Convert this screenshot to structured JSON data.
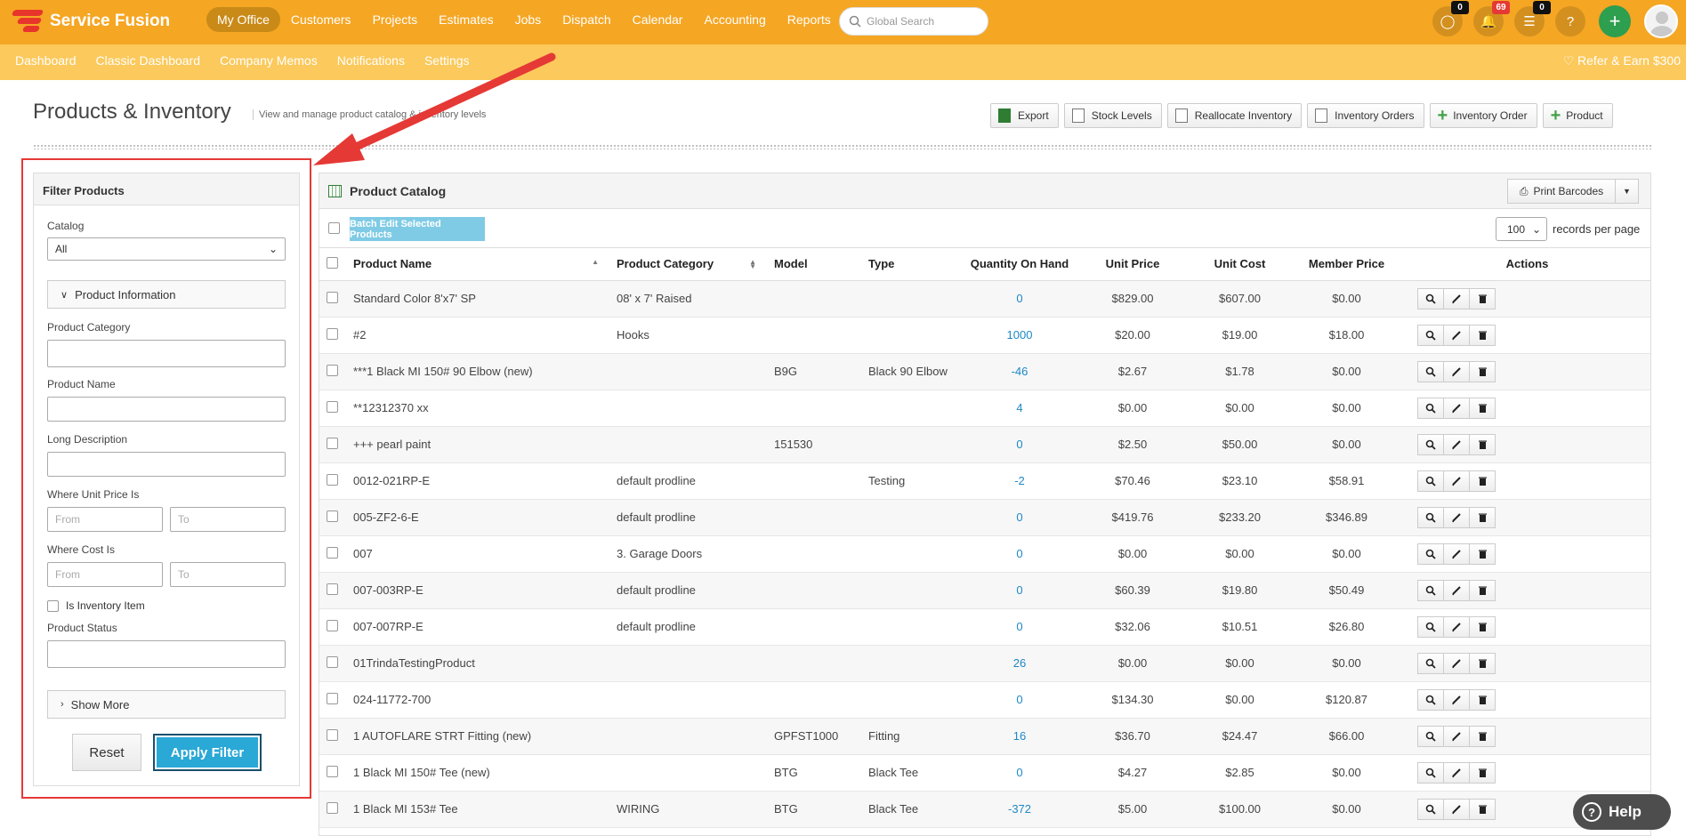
{
  "brand": {
    "name": "Service Fusion"
  },
  "nav": [
    "My Office",
    "Customers",
    "Projects",
    "Estimates",
    "Jobs",
    "Dispatch",
    "Calendar",
    "Accounting",
    "Reports"
  ],
  "nav_active": "My Office",
  "search": {
    "placeholder": "Global Search"
  },
  "badges": {
    "chat": "0",
    "notifications": "69",
    "tasks": "0"
  },
  "subnav": [
    "Dashboard",
    "Classic Dashboard",
    "Company Memos",
    "Notifications",
    "Settings"
  ],
  "refer": "Refer & Earn $300",
  "page": {
    "title": "Products & Inventory",
    "subtitle": "View and manage product catalog & inventory levels"
  },
  "actions": {
    "export": "Export",
    "stock": "Stock Levels",
    "reallocate": "Reallocate Inventory",
    "orders": "Inventory Orders",
    "order": "Inventory Order",
    "product": "Product"
  },
  "filter": {
    "title": "Filter Products",
    "catalog_label": "Catalog",
    "catalog_value": "All",
    "product_info": "Product Information",
    "category_label": "Product Category",
    "name_label": "Product Name",
    "desc_label": "Long Description",
    "unit_price_label": "Where Unit Price Is",
    "cost_label": "Where Cost Is",
    "from_placeholder": "From",
    "to_placeholder": "To",
    "inventory_label": "Is Inventory Item",
    "status_label": "Product Status",
    "show_more": "Show More",
    "reset": "Reset",
    "apply": "Apply Filter"
  },
  "catalog": {
    "title": "Product Catalog",
    "print_barcodes": "Print Barcodes",
    "batch_edit": "Batch Edit Selected Products",
    "rpp_value": "100",
    "rpp_label": "records per page",
    "columns": [
      "Product Name",
      "Product Category",
      "Model",
      "Type",
      "Quantity On Hand",
      "Unit Price",
      "Unit Cost",
      "Member Price",
      "Actions"
    ],
    "rows": [
      {
        "name": "Standard Color 8'x7' SP",
        "category": "08' x 7' Raised",
        "model": "",
        "type": "",
        "qty": "0",
        "price": "$829.00",
        "cost": "$607.00",
        "member": "$0.00"
      },
      {
        "name": "#2",
        "category": "Hooks",
        "model": "",
        "type": "",
        "qty": "1000",
        "price": "$20.00",
        "cost": "$19.00",
        "member": "$18.00"
      },
      {
        "name": "***1 Black MI 150# 90 Elbow (new)",
        "category": "",
        "model": "B9G",
        "type": "Black 90 Elbow",
        "qty": "-46",
        "price": "$2.67",
        "cost": "$1.78",
        "member": "$0.00"
      },
      {
        "name": "**12312370 xx",
        "category": "",
        "model": "",
        "type": "",
        "qty": "4",
        "price": "$0.00",
        "cost": "$0.00",
        "member": "$0.00"
      },
      {
        "name": "+++ pearl paint",
        "category": "",
        "model": "151530",
        "type": "",
        "qty": "0",
        "price": "$2.50",
        "cost": "$50.00",
        "member": "$0.00"
      },
      {
        "name": "0012-021RP-E",
        "category": "default prodline",
        "model": "",
        "type": "Testing",
        "qty": "-2",
        "price": "$70.46",
        "cost": "$23.10",
        "member": "$58.91"
      },
      {
        "name": "005-ZF2-6-E",
        "category": "default prodline",
        "model": "",
        "type": "",
        "qty": "0",
        "price": "$419.76",
        "cost": "$233.20",
        "member": "$346.89"
      },
      {
        "name": "007",
        "category": "3. Garage Doors",
        "model": "",
        "type": "",
        "qty": "0",
        "price": "$0.00",
        "cost": "$0.00",
        "member": "$0.00"
      },
      {
        "name": "007-003RP-E",
        "category": "default prodline",
        "model": "",
        "type": "",
        "qty": "0",
        "price": "$60.39",
        "cost": "$19.80",
        "member": "$50.49"
      },
      {
        "name": "007-007RP-E",
        "category": "default prodline",
        "model": "",
        "type": "",
        "qty": "0",
        "price": "$32.06",
        "cost": "$10.51",
        "member": "$26.80"
      },
      {
        "name": "01TrindaTestingProduct",
        "category": "",
        "model": "",
        "type": "",
        "qty": "26",
        "price": "$0.00",
        "cost": "$0.00",
        "member": "$0.00"
      },
      {
        "name": "024-11772-700",
        "category": "",
        "model": "",
        "type": "",
        "qty": "0",
        "price": "$134.30",
        "cost": "$0.00",
        "member": "$120.87"
      },
      {
        "name": "1 AUTOFLARE STRT Fitting (new)",
        "category": "",
        "model": "GPFST1000",
        "type": "Fitting",
        "qty": "16",
        "price": "$36.70",
        "cost": "$24.47",
        "member": "$66.00"
      },
      {
        "name": "1 Black MI 150# Tee (new)",
        "category": "",
        "model": "BTG",
        "type": "Black Tee",
        "qty": "0",
        "price": "$4.27",
        "cost": "$2.85",
        "member": "$0.00"
      },
      {
        "name": "1 Black MI 153# Tee",
        "category": "WIRING",
        "model": "BTG",
        "type": "Black Tee",
        "qty": "-372",
        "price": "$5.00",
        "cost": "$100.00",
        "member": "$0.00"
      }
    ]
  },
  "help": "Help"
}
